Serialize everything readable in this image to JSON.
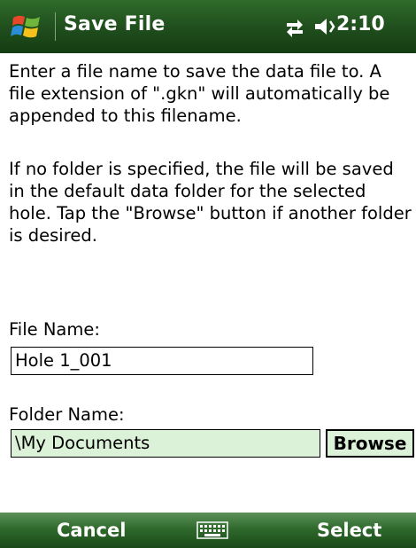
{
  "titlebar": {
    "title": "Save File",
    "time": "2:10",
    "icons": [
      "windows-start-icon",
      "connectivity-icon",
      "volume-icon"
    ]
  },
  "content": {
    "paragraph1": "Enter a file name to save the data file to. A file extension of \".gkn\" will automatically be appended to this filename.",
    "paragraph2": "If no folder is specified, the file will be saved in the default data folder for the selected hole. Tap the \"Browse\" button if another folder is desired.",
    "file_name_label": "File Name:",
    "file_name_value": "Hole 1_001",
    "folder_name_label": "Folder Name:",
    "folder_name_value": "\\My Documents",
    "browse_label": "Browse"
  },
  "softkeys": {
    "left": "Cancel",
    "center_icon": "keyboard-icon",
    "right": "Select"
  },
  "colors": {
    "titlebar": "#1f4d1c",
    "softbar": "#2f6a2c",
    "field_highlight": "#dcf2d8"
  }
}
